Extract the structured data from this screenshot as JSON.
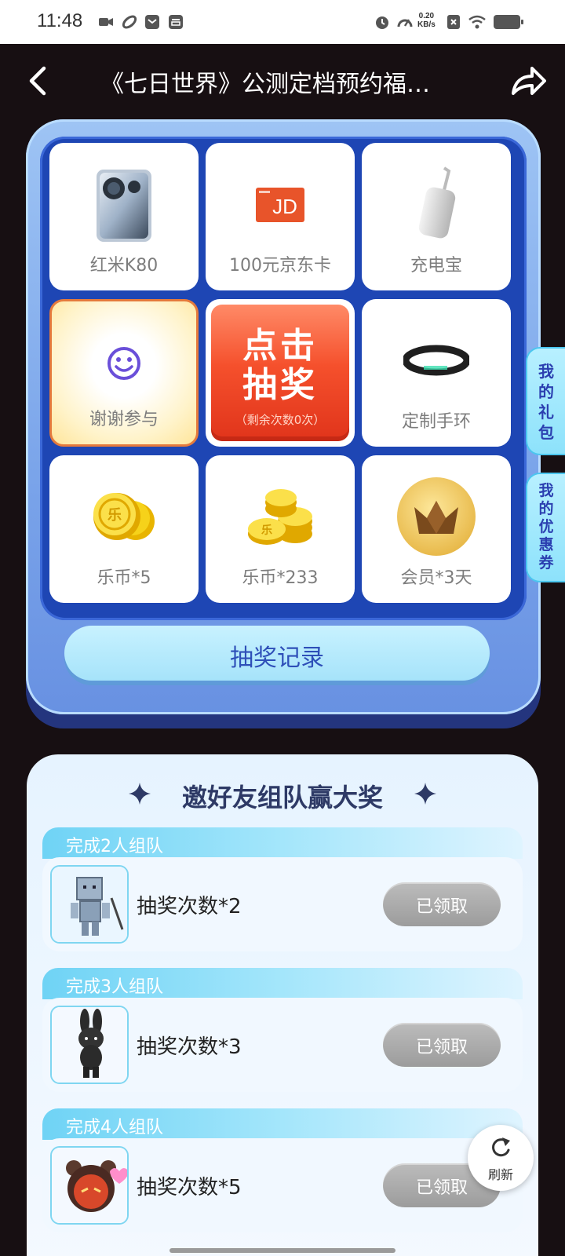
{
  "status_bar": {
    "time": "11:48",
    "net_speed_value": "0.20",
    "net_speed_unit": "KB/s",
    "icons": [
      "video-icon",
      "link-icon",
      "mail-icon",
      "inbox-icon",
      "alarm-icon",
      "speed-icon",
      "close-box-icon",
      "wifi-icon",
      "battery-icon"
    ]
  },
  "header": {
    "title": "《七日世界》公测定档预约福…",
    "back_icon": "back-chevron-icon",
    "share_icon": "share-arrow-icon"
  },
  "lottery": {
    "prizes": [
      {
        "label": "红米K80",
        "icon": "phone-image"
      },
      {
        "label": "100元京东卡",
        "icon": "jd-card-image"
      },
      {
        "label": "充电宝",
        "icon": "power-bank-image"
      },
      {
        "label": "谢谢参与",
        "icon": "smiley-icon"
      },
      {
        "label": "定制手环",
        "icon": "wristband-image"
      },
      {
        "label": "乐币*5",
        "icon": "coins-image"
      },
      {
        "label": "乐币*233",
        "icon": "coin-stack-image"
      },
      {
        "label": "会员*3天",
        "icon": "crown-icon"
      }
    ],
    "draw_button": {
      "line1": "点击",
      "line2": "抽奖",
      "remaining": "（剩余次数0次）"
    },
    "record_button": "抽奖记录",
    "colors": {
      "draw": "#f04f2b",
      "grid": "#1e46b4",
      "panel": "#7aa4ea"
    }
  },
  "side_tabs": {
    "gifts": "我的礼包",
    "coupons": "我的优惠券"
  },
  "team_section": {
    "title": "邀好友组队赢大奖",
    "cards": [
      {
        "head": "完成2人组队",
        "reward": "抽奖次数*2",
        "button": "已领取",
        "image": "block-robot-figure"
      },
      {
        "head": "完成3人组队",
        "reward": "抽奖次数*3",
        "button": "已领取",
        "image": "dark-bunny-figure"
      },
      {
        "head": "完成4人组队",
        "reward": "抽奖次数*5",
        "button": "已领取",
        "image": "red-bear-figure"
      }
    ]
  },
  "refresh_button": "刷新"
}
